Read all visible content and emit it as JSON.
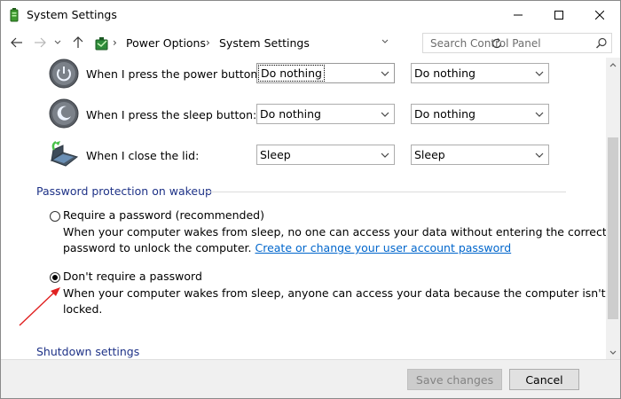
{
  "window": {
    "title": "System Settings"
  },
  "address": {
    "path": [
      "Power Options",
      "System Settings"
    ],
    "search_placeholder": "Search Control Panel"
  },
  "buttons_section": {
    "rows": [
      {
        "label": "When I press the power button:",
        "on_battery": "Do nothing",
        "plugged_in": "Do nothing"
      },
      {
        "label": "When I press the sleep button:",
        "on_battery": "Do nothing",
        "plugged_in": "Do nothing"
      },
      {
        "label": "When I close the lid:",
        "on_battery": "Sleep",
        "plugged_in": "Sleep"
      }
    ]
  },
  "password_section": {
    "heading": "Password protection on wakeup",
    "require": {
      "label": "Require a password (recommended)",
      "selected": false,
      "desc_line1": "When your computer wakes from sleep, no one can access your data without entering the correct",
      "desc_line2": "password to unlock the computer.",
      "link": "Create or change your user account password"
    },
    "dont_require": {
      "label": "Don't require a password",
      "selected": true,
      "desc_line1": "When your computer wakes from sleep, anyone can access your data because the computer isn't",
      "desc_line2": "locked."
    }
  },
  "shutdown_section": {
    "heading": "Shutdown settings"
  },
  "footer": {
    "save_label": "Save changes",
    "cancel_label": "Cancel"
  },
  "colors": {
    "heading": "#1e3287",
    "link": "#0066cc",
    "annotation_arrow": "#e02020"
  }
}
